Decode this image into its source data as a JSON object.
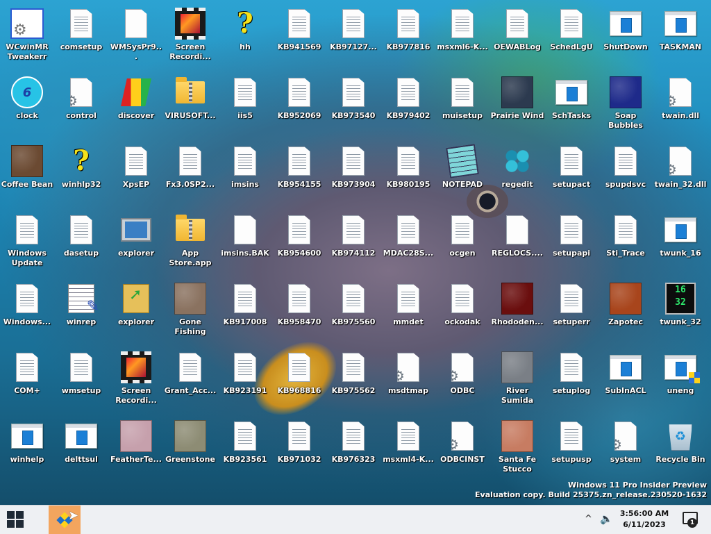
{
  "desktop": {
    "icons": [
      {
        "label": "WCwinMR Tweakerr",
        "icon": "tweaker-icon"
      },
      {
        "label": "comsetup",
        "icon": "document-icon"
      },
      {
        "label": "WMSysPr9...",
        "icon": "blank-document-icon"
      },
      {
        "label": "Screen Recordi...",
        "icon": "film-icon"
      },
      {
        "label": "hh",
        "icon": "help-icon"
      },
      {
        "label": "KB941569",
        "icon": "document-icon"
      },
      {
        "label": "KB97127...",
        "icon": "document-icon"
      },
      {
        "label": "KB977816",
        "icon": "document-icon"
      },
      {
        "label": "msxml6-K...",
        "icon": "document-icon"
      },
      {
        "label": "OEWABLog",
        "icon": "document-icon"
      },
      {
        "label": "SchedLgU",
        "icon": "document-icon"
      },
      {
        "label": "ShutDown",
        "icon": "window-icon"
      },
      {
        "label": "TASKMAN",
        "icon": "window-icon"
      },
      {
        "label": "clock",
        "icon": "clock-icon"
      },
      {
        "label": "control",
        "icon": "settings-document-icon"
      },
      {
        "label": "discover",
        "icon": "discover-icon"
      },
      {
        "label": "VIRUSOFT...",
        "icon": "zip-folder-icon"
      },
      {
        "label": "iis5",
        "icon": "document-icon"
      },
      {
        "label": "KB952069",
        "icon": "document-icon"
      },
      {
        "label": "KB973540",
        "icon": "document-icon"
      },
      {
        "label": "KB979402",
        "icon": "document-icon"
      },
      {
        "label": "muisetup",
        "icon": "document-icon"
      },
      {
        "label": "Prairie Wind",
        "icon": "texture-icon"
      },
      {
        "label": "SchTasks",
        "icon": "window-icon"
      },
      {
        "label": "Soap Bubbles",
        "icon": "texture-icon"
      },
      {
        "label": "twain.dll",
        "icon": "settings-document-icon"
      },
      {
        "label": "Coffee Bean",
        "icon": "texture-icon"
      },
      {
        "label": "winhlp32",
        "icon": "help-icon"
      },
      {
        "label": "XpsEP",
        "icon": "document-icon"
      },
      {
        "label": "Fx3.0SP2...",
        "icon": "document-icon"
      },
      {
        "label": "imsins",
        "icon": "document-icon"
      },
      {
        "label": "KB954155",
        "icon": "document-icon"
      },
      {
        "label": "KB973904",
        "icon": "document-icon"
      },
      {
        "label": "KB980195",
        "icon": "document-icon"
      },
      {
        "label": "NOTEPAD",
        "icon": "notepad-icon"
      },
      {
        "label": "regedit",
        "icon": "regedit-icon"
      },
      {
        "label": "setupact",
        "icon": "document-icon"
      },
      {
        "label": "spupdsvc",
        "icon": "document-icon"
      },
      {
        "label": "twain_32.dll",
        "icon": "settings-document-icon"
      },
      {
        "label": "Windows Update",
        "icon": "document-icon"
      },
      {
        "label": "dasetup",
        "icon": "document-icon"
      },
      {
        "label": "explorer",
        "icon": "computer-icon"
      },
      {
        "label": "App Store.app",
        "icon": "zip-folder-icon"
      },
      {
        "label": "imsins.BAK",
        "icon": "blank-document-icon"
      },
      {
        "label": "KB954600",
        "icon": "document-icon"
      },
      {
        "label": "KB974112",
        "icon": "document-icon"
      },
      {
        "label": "MDAC28S...",
        "icon": "document-icon"
      },
      {
        "label": "ocgen",
        "icon": "document-icon"
      },
      {
        "label": "REGLOCS....",
        "icon": "blank-document-icon"
      },
      {
        "label": "setupapi",
        "icon": "document-icon"
      },
      {
        "label": "Sti_Trace",
        "icon": "document-icon"
      },
      {
        "label": "twunk_16",
        "icon": "window-icon"
      },
      {
        "label": "Windows...",
        "icon": "document-icon"
      },
      {
        "label": "winrep",
        "icon": "winrep-icon"
      },
      {
        "label": "explorer",
        "icon": "explorer-folder-icon"
      },
      {
        "label": "Gone Fishing",
        "icon": "texture-icon"
      },
      {
        "label": "KB917008",
        "icon": "document-icon"
      },
      {
        "label": "KB958470",
        "icon": "document-icon"
      },
      {
        "label": "KB975560",
        "icon": "document-icon"
      },
      {
        "label": "mmdet",
        "icon": "document-icon"
      },
      {
        "label": "ockodak",
        "icon": "document-icon"
      },
      {
        "label": "Rhododen...",
        "icon": "texture-icon"
      },
      {
        "label": "setuperr",
        "icon": "document-icon"
      },
      {
        "label": "Zapotec",
        "icon": "texture-icon"
      },
      {
        "label": "twunk_32",
        "icon": "twunk32-icon"
      },
      {
        "label": "COM+",
        "icon": "document-icon"
      },
      {
        "label": "wmsetup",
        "icon": "document-icon"
      },
      {
        "label": "Screen Recordi...",
        "icon": "film-icon"
      },
      {
        "label": "Grant_Acc...",
        "icon": "document-icon"
      },
      {
        "label": "KB923191",
        "icon": "document-icon"
      },
      {
        "label": "KB968816",
        "icon": "document-icon"
      },
      {
        "label": "KB975562",
        "icon": "document-icon"
      },
      {
        "label": "msdtmap",
        "icon": "settings-document-icon"
      },
      {
        "label": "ODBC",
        "icon": "settings-document-icon"
      },
      {
        "label": "River Sumida",
        "icon": "texture-icon"
      },
      {
        "label": "setuplog",
        "icon": "document-icon"
      },
      {
        "label": "SubInACL",
        "icon": "window-icon"
      },
      {
        "label": "uneng",
        "icon": "window-shield-icon"
      },
      {
        "label": "winhelp",
        "icon": "window-icon"
      },
      {
        "label": "delttsul",
        "icon": "window-icon"
      },
      {
        "label": "FeatherTe...",
        "icon": "texture-icon"
      },
      {
        "label": "Greenstone",
        "icon": "texture-icon"
      },
      {
        "label": "KB923561",
        "icon": "document-icon"
      },
      {
        "label": "KB971032",
        "icon": "document-icon"
      },
      {
        "label": "KB976323",
        "icon": "document-icon"
      },
      {
        "label": "msxml4-K...",
        "icon": "document-icon"
      },
      {
        "label": "ODBCINST",
        "icon": "settings-document-icon"
      },
      {
        "label": "Santa Fe Stucco",
        "icon": "texture-icon"
      },
      {
        "label": "setupusp",
        "icon": "document-icon"
      },
      {
        "label": "system",
        "icon": "settings-document-icon"
      },
      {
        "label": "Recycle Bin",
        "icon": "recycle-bin-icon"
      }
    ],
    "texture_colors": {
      "Prairie Wind": "#2c3a4f",
      "Soap Bubbles": "#1e2a8a",
      "Coffee Bean": "#6b4a32",
      "Gone Fishing": "#8a7260",
      "Rhododen...": "#6a0e0e",
      "Zapotec": "#a8451c",
      "River Sumida": "#7a7f86",
      "FeatherTe...": "#c6a0ac",
      "Greenstone": "#8d8c74",
      "Santa Fe Stucco": "#c77c62"
    }
  },
  "watermark": {
    "line1": "Windows 11 Pro Insider Preview",
    "line2": "Evaluation copy. Build 25375.zn_release.230520-1632"
  },
  "taskbar": {
    "time": "3:56:00 AM",
    "date": "6/11/2023",
    "notification_count": "1",
    "tray": {
      "chevron": "^",
      "speaker": "🔈"
    },
    "accent_color": "#f3a55e"
  }
}
